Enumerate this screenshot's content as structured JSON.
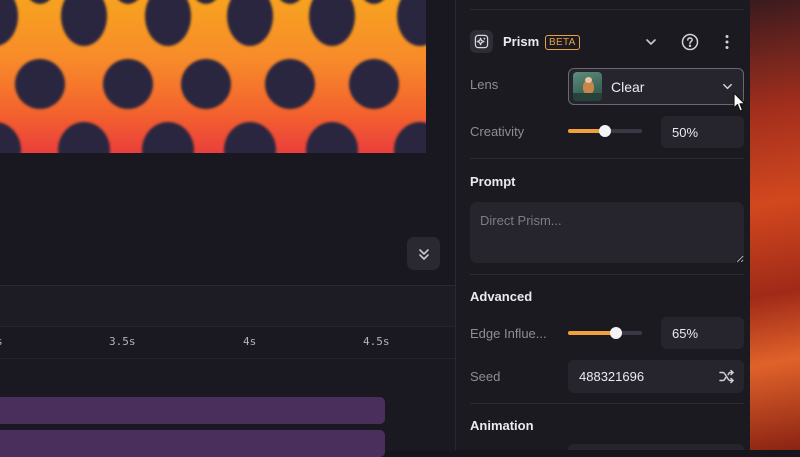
{
  "timeline": {
    "ticks": [
      {
        "label": "s"
      },
      {
        "label": "3.5s"
      },
      {
        "label": "4s"
      },
      {
        "label": "4.5s"
      }
    ]
  },
  "panel": {
    "effect_name": "Prism",
    "beta_badge": "BETA",
    "lens": {
      "label": "Lens",
      "value": "Clear"
    },
    "creativity": {
      "label": "Creativity",
      "value": "50%",
      "level": 0.5
    },
    "prompt": {
      "title": "Prompt",
      "placeholder": "Direct Prism..."
    },
    "advanced": {
      "title": "Advanced",
      "edge_influence": {
        "label": "Edge Influe...",
        "value": "65%",
        "level": 0.65
      },
      "seed": {
        "label": "Seed",
        "value": "488321696"
      }
    },
    "animation": {
      "title": "Animation"
    }
  },
  "colors": {
    "accent": "#f2a03a",
    "beta_badge": "#e7a247",
    "track": "#4a2f5c",
    "panel_bg": "#1c1a21",
    "field_bg": "#26242c",
    "canvas_gradient": [
      "#f7a21f",
      "#ea3f3c"
    ],
    "canvas_pattern": "#2a2740"
  },
  "icons": {
    "effect": "sparkle-icon",
    "collapse": "chevron-double-down-icon",
    "chevron": "chevron-down-icon",
    "help": "help-icon",
    "more": "more-vertical-icon",
    "shuffle": "shuffle-icon",
    "cursor": "mouse-pointer-icon"
  }
}
